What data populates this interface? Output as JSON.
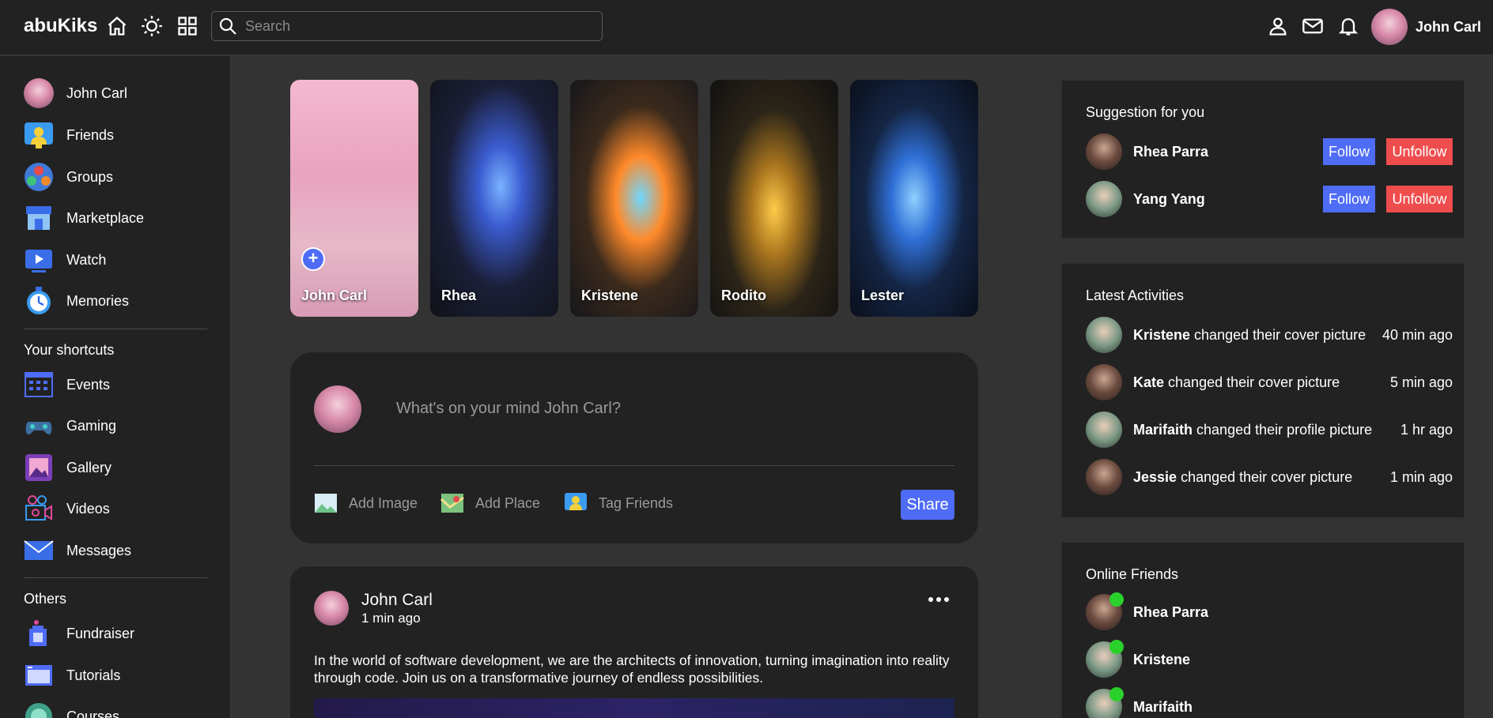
{
  "app": {
    "name": "abuKiks"
  },
  "search": {
    "placeholder": "Search"
  },
  "user": {
    "name": "John Carl"
  },
  "colors": {
    "accent": "#4f6cf7",
    "danger": "#ef4d4d",
    "online": "#2bd12b"
  },
  "sidebar": {
    "main": [
      {
        "label": "John Carl",
        "icon": "avatar"
      },
      {
        "label": "Friends",
        "icon": "friends-icon"
      },
      {
        "label": "Groups",
        "icon": "groups-icon"
      },
      {
        "label": "Marketplace",
        "icon": "marketplace-icon"
      },
      {
        "label": "Watch",
        "icon": "watch-icon"
      },
      {
        "label": "Memories",
        "icon": "memories-icon"
      }
    ],
    "shortcuts_title": "Your shortcuts",
    "shortcuts": [
      {
        "label": "Events",
        "icon": "calendar-icon"
      },
      {
        "label": "Gaming",
        "icon": "gamepad-icon"
      },
      {
        "label": "Gallery",
        "icon": "gallery-icon"
      },
      {
        "label": "Videos",
        "icon": "video-camera-icon"
      },
      {
        "label": "Messages",
        "icon": "mail-icon"
      }
    ],
    "others_title": "Others",
    "others": [
      {
        "label": "Fundraiser",
        "icon": "fundraiser-icon"
      },
      {
        "label": "Tutorials",
        "icon": "tutorials-icon"
      },
      {
        "label": "Courses",
        "icon": "courses-icon"
      }
    ]
  },
  "stories": [
    {
      "name": "John Carl"
    },
    {
      "name": "Rhea"
    },
    {
      "name": "Kristene"
    },
    {
      "name": "Rodito"
    },
    {
      "name": "Lester"
    }
  ],
  "composer": {
    "prompt": "What's on your mind John Carl?",
    "add_image": "Add Image",
    "add_place": "Add Place",
    "tag_friends": "Tag Friends",
    "share": "Share"
  },
  "post": {
    "author": "John Carl",
    "time": "1 min ago",
    "text": "In the world of software development, we are the architects of innovation, turning imagination into reality through code. Join us on a transformative journey of endless possibilities."
  },
  "suggestions": {
    "title": "Suggestion for you",
    "follow": "Follow",
    "unfollow": "Unfollow",
    "items": [
      {
        "name": "Rhea Parra"
      },
      {
        "name": "Yang Yang"
      }
    ]
  },
  "activities": {
    "title": "Latest Activities",
    "items": [
      {
        "name": "Kristene",
        "action": "changed their cover picture",
        "time": "40 min ago"
      },
      {
        "name": "Kate",
        "action": "changed their cover picture",
        "time": "5 min ago"
      },
      {
        "name": "Marifaith",
        "action": "changed their profile picture",
        "time": "1 hr ago"
      },
      {
        "name": "Jessie",
        "action": "changed their cover picture",
        "time": "1 min ago"
      }
    ]
  },
  "online": {
    "title": "Online Friends",
    "items": [
      {
        "name": "Rhea Parra"
      },
      {
        "name": "Kristene"
      },
      {
        "name": "Marifaith"
      }
    ]
  }
}
